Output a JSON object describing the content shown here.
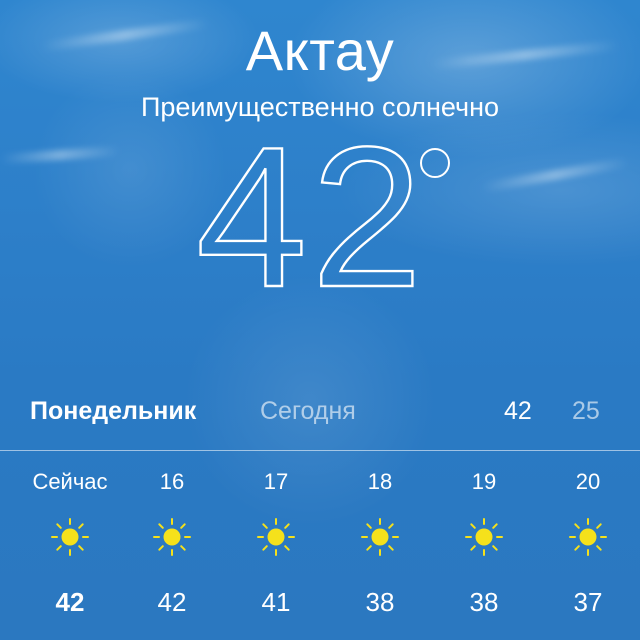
{
  "header": {
    "city": "Актау",
    "condition": "Преимущественно солнечно",
    "temperature": "42",
    "unit_symbol": "°"
  },
  "today": {
    "day_name": "Понедельник",
    "label": "Сегодня",
    "high": "42",
    "low": "25"
  },
  "hourly": [
    {
      "time": "Сейчас",
      "icon": "sun-icon",
      "temp": "42"
    },
    {
      "time": "16",
      "icon": "sun-icon",
      "temp": "42"
    },
    {
      "time": "17",
      "icon": "sun-icon",
      "temp": "41"
    },
    {
      "time": "18",
      "icon": "sun-icon",
      "temp": "38"
    },
    {
      "time": "19",
      "icon": "sun-icon",
      "temp": "38"
    },
    {
      "time": "20",
      "icon": "sun-icon",
      "temp": "37"
    }
  ],
  "colors": {
    "sky": "#2d7fc9",
    "sun": "#f5e11b",
    "text": "#ffffff"
  }
}
